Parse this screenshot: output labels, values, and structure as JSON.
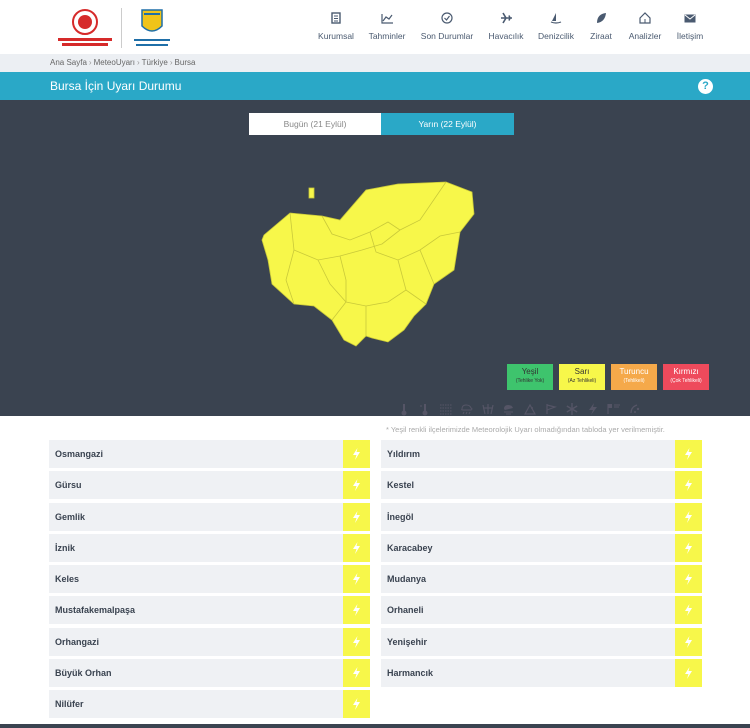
{
  "nav": [
    {
      "label": "Kurumsal",
      "icon": "building-icon"
    },
    {
      "label": "Tahminler",
      "icon": "chart-icon"
    },
    {
      "label": "Son Durumlar",
      "icon": "gauge-icon"
    },
    {
      "label": "Havacılık",
      "icon": "plane-icon"
    },
    {
      "label": "Denizcilik",
      "icon": "sailboat-icon"
    },
    {
      "label": "Ziraat",
      "icon": "leaf-icon"
    },
    {
      "label": "Analizler",
      "icon": "home-chart-icon"
    },
    {
      "label": "İletişim",
      "icon": "mail-icon"
    }
  ],
  "breadcrumb": [
    "Ana Sayfa",
    "MeteoUyarı",
    "Türkiye",
    "Bursa"
  ],
  "title": "Bursa İçin Uyarı Durumu",
  "tabs": {
    "today": "Bugün (21 Eylül)",
    "tomorrow": "Yarın (22 Eylül)"
  },
  "legend": [
    {
      "label": "Yeşil",
      "sub": "(Tehlike Yok)",
      "color": "#3ec46d"
    },
    {
      "label": "Sarı",
      "sub": "(Az Tehlikeli)",
      "color": "#f7f74a"
    },
    {
      "label": "Turuncu",
      "sub": "(Tehlikeli)",
      "color": "#f5a94a"
    },
    {
      "label": "Kırmızı",
      "sub": "(Çok Tehlikeli)",
      "color": "#ee4a5c"
    }
  ],
  "params": [
    "thermometer-hot-icon",
    "thermometer-cold-icon",
    "fog-icon",
    "rain-icon",
    "snow-icon",
    "storm-icon",
    "avalanche-icon",
    "wind-icon",
    "frost-icon",
    "lightning-icon",
    "flag-icon",
    "dust-icon"
  ],
  "note": "* Yeşil renkli ilçelerimizde Meteorolojik Uyarı olmadığından tabloda yer verilmemiştir.",
  "districts_left": [
    "Osmangazi",
    "Gürsu",
    "Gemlik",
    "İznik",
    "Keles",
    "Mustafakemalpaşa",
    "Orhangazi",
    "Büyük Orhan",
    "Nilüfer"
  ],
  "districts_right": [
    "Yıldırım",
    "Kestel",
    "İnegöl",
    "Karacabey",
    "Mudanya",
    "Orhaneli",
    "Yenişehir",
    "Harmancık"
  ],
  "colors": {
    "accent": "#2aa8c7",
    "warning_yellow": "#f7f74a",
    "panel": "#3a4350"
  }
}
